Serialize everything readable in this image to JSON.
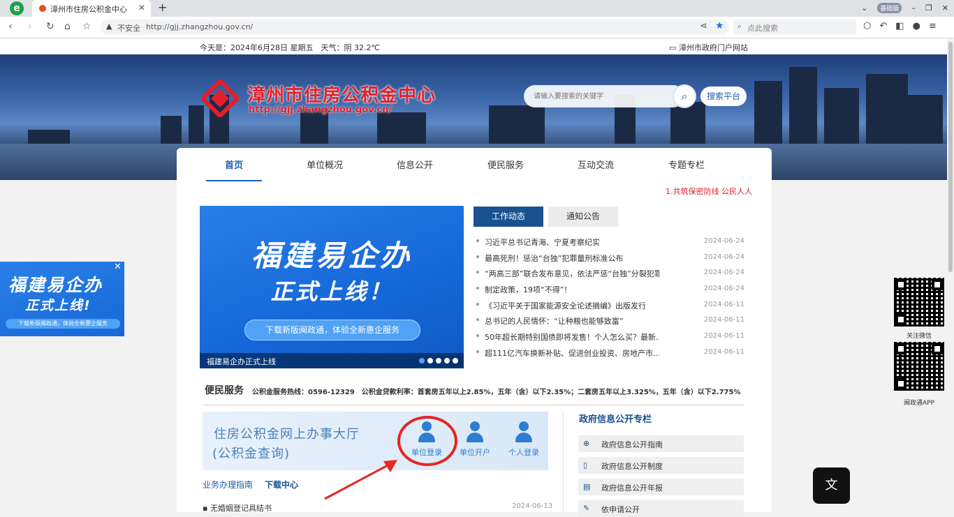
{
  "browser": {
    "tab_title": "漳州市住房公积金中心",
    "url": "http://gjj.zhangzhou.gov.cn/",
    "security_label": "不安全",
    "search_placeholder": "点此搜索",
    "version_badge": "基础版"
  },
  "topbar": {
    "date_weather": "今天是：2024年6月28日 星期五　天气：阴 32.2℃",
    "gov_portal": "漳州市政府门户网站"
  },
  "header": {
    "site_title": "漳州市住房公积金中心",
    "site_url": "http://gjj.zhangzhou.gov.cn/",
    "search_placeholder": "请输入要搜索的关键字",
    "search_platform": "搜索平台"
  },
  "nav": {
    "items": [
      "首页",
      "单位概况",
      "信息公开",
      "便民服务",
      "互动交流",
      "专题专栏"
    ]
  },
  "marquee": "1.共筑保密防线 公民人人",
  "slider": {
    "title_line1": "福建易企办",
    "title_line2": "正式上线！",
    "button": "下载新版闽政通，体验全新惠企服务",
    "caption": "福建易企办正式上线"
  },
  "news": {
    "tab_active": "工作动态",
    "tab_other": "通知公告",
    "items": [
      {
        "title": "习近平总书记青海、宁夏考察纪实",
        "date": "2024-06-24"
      },
      {
        "title": "最高死刑！惩治“台独”犯罪量刑标准公布",
        "date": "2024-06-24"
      },
      {
        "title": "“两高三部”联合发布意见，依法严惩“台独”分裂犯罪",
        "date": "2024-06-24"
      },
      {
        "title": "制定政策，19项“不得”！",
        "date": "2024-06-24"
      },
      {
        "title": "《习近平关于国家能源安全论述摘编》出版发行",
        "date": "2024-06-11"
      },
      {
        "title": "总书记的人民情怀：“让种粮也能够致富”",
        "date": "2024-06-11"
      },
      {
        "title": "50年超长期特别国债即将发售！个人怎么买？最新...",
        "date": "2024-06-11"
      },
      {
        "title": "超111亿汽车换新补贴、促进创业投资、房地产市...",
        "date": "2024-06-11"
      }
    ]
  },
  "service": {
    "heading": "便民服务",
    "info": "公积金服务热线：0596-12329　公积金贷款利率：首套房五年以上2.85%，五年（含）以下2.35%；二套房五年以上3.325%，五年（含）以下2.775%",
    "hall_line1": "住房公积金网上办事大厅",
    "hall_line2": "(公积金查询)",
    "buttons": [
      "单位登录",
      "单位开户",
      "个人登录"
    ],
    "tab_guide": "业务办理指南",
    "tab_download": "下载中心",
    "download_item": "无婚姻登记具结书",
    "download_date": "2024-06-13"
  },
  "gov_info": {
    "heading": "政府信息公开专栏",
    "items": [
      "政府信息公开指南",
      "政府信息公开制度",
      "政府信息公开年报",
      "依申请公开"
    ]
  },
  "float_ad": {
    "line1": "福建易企办",
    "line2": "正式上线!",
    "line3": "下载新版闽政通，体验全新惠企服务"
  },
  "qr": {
    "label1": "关注微信",
    "label2": "闽政通APP"
  },
  "colors": {
    "brand_blue": "#19518f",
    "brand_red": "#e61e2a",
    "highlight": "#e6261f"
  }
}
